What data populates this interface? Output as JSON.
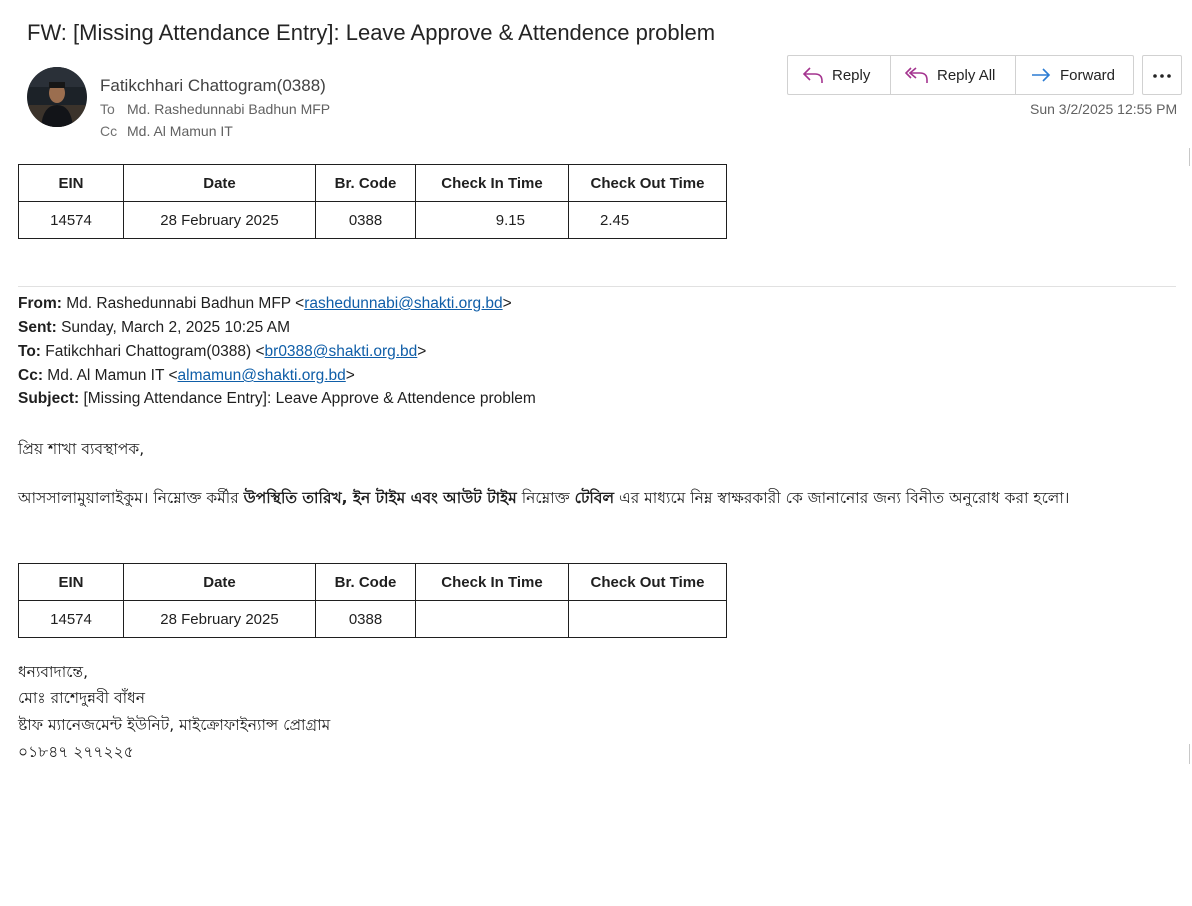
{
  "email": {
    "subject": "FW: [Missing Attendance Entry]: Leave Approve & Attendence problem",
    "sender": "Fatikchhari Chattogram(0388)",
    "to_label": "To",
    "to": "Md. Rashedunnabi Badhun MFP",
    "cc_label": "Cc",
    "cc": "Md. Al Mamun IT",
    "datetime": "Sun 3/2/2025 12:55 PM"
  },
  "actions": {
    "reply": "Reply",
    "reply_all": "Reply All",
    "forward": "Forward",
    "more": "More actions"
  },
  "table_headers": [
    "EIN",
    "Date",
    "Br. Code",
    "Check In Time",
    "Check Out Time"
  ],
  "top_table": {
    "ein": "14574",
    "date": "28 February 2025",
    "br_code": "0388",
    "check_in": "9.15",
    "check_out": "2.45"
  },
  "forwarded": {
    "from_label": "From:",
    "from_name": "Md. Rashedunnabi Badhun MFP <",
    "from_email": "rashedunnabi@shakti.org.bd",
    "sent_label": "Sent:",
    "sent": "Sunday, March 2, 2025 10:25 AM",
    "to_label": "To:",
    "to_name": "Fatikchhari Chattogram(0388) <",
    "to_email": "br0388@shakti.org.bd",
    "cc_label": "Cc:",
    "cc_name": "Md. Al Mamun IT <",
    "cc_email": "almamun@shakti.org.bd",
    "subject_label": "Subject:",
    "subject": "[Missing Attendance Entry]: Leave Approve & Attendence problem",
    "close_bracket": ">"
  },
  "body": {
    "greeting": "প্রিয় শাখা ব্যবস্থাপক,",
    "para_1": "আসসালামুয়ালাইকুম। নিম্নোক্ত কর্মীর ",
    "para_bold_1": "উপস্থিতি তারিখ, ইন টাইম এবং আউট টাইম",
    "para_2": " নিম্নোক্ত ",
    "para_bold_2": "টেবিল",
    "para_3": " এর মাধ্যমে নিম্ন স্বাক্ষরকারী কে জানানোর জন্য বিনীত অনুরোধ করা হলো।"
  },
  "bottom_table": {
    "ein": "14574",
    "date": "28 February 2025",
    "br_code": "0388",
    "check_in": "",
    "check_out": ""
  },
  "signature": {
    "thanks": "ধন্যবাদান্তে,",
    "name": "মোঃ রাশেদুন্নবী বাঁধন",
    "unit": "ষ্টাফ ম্যানেজমেন্ট ইউনিট, মাইক্রোফাইন্যান্স প্রোগ্রাম",
    "phone": "০১৮৪৭ ২৭৭২২৫"
  },
  "colors": {
    "link": "#0f5ea8",
    "reply_icon": "#a4348f",
    "forward_icon": "#2b7cd3"
  }
}
